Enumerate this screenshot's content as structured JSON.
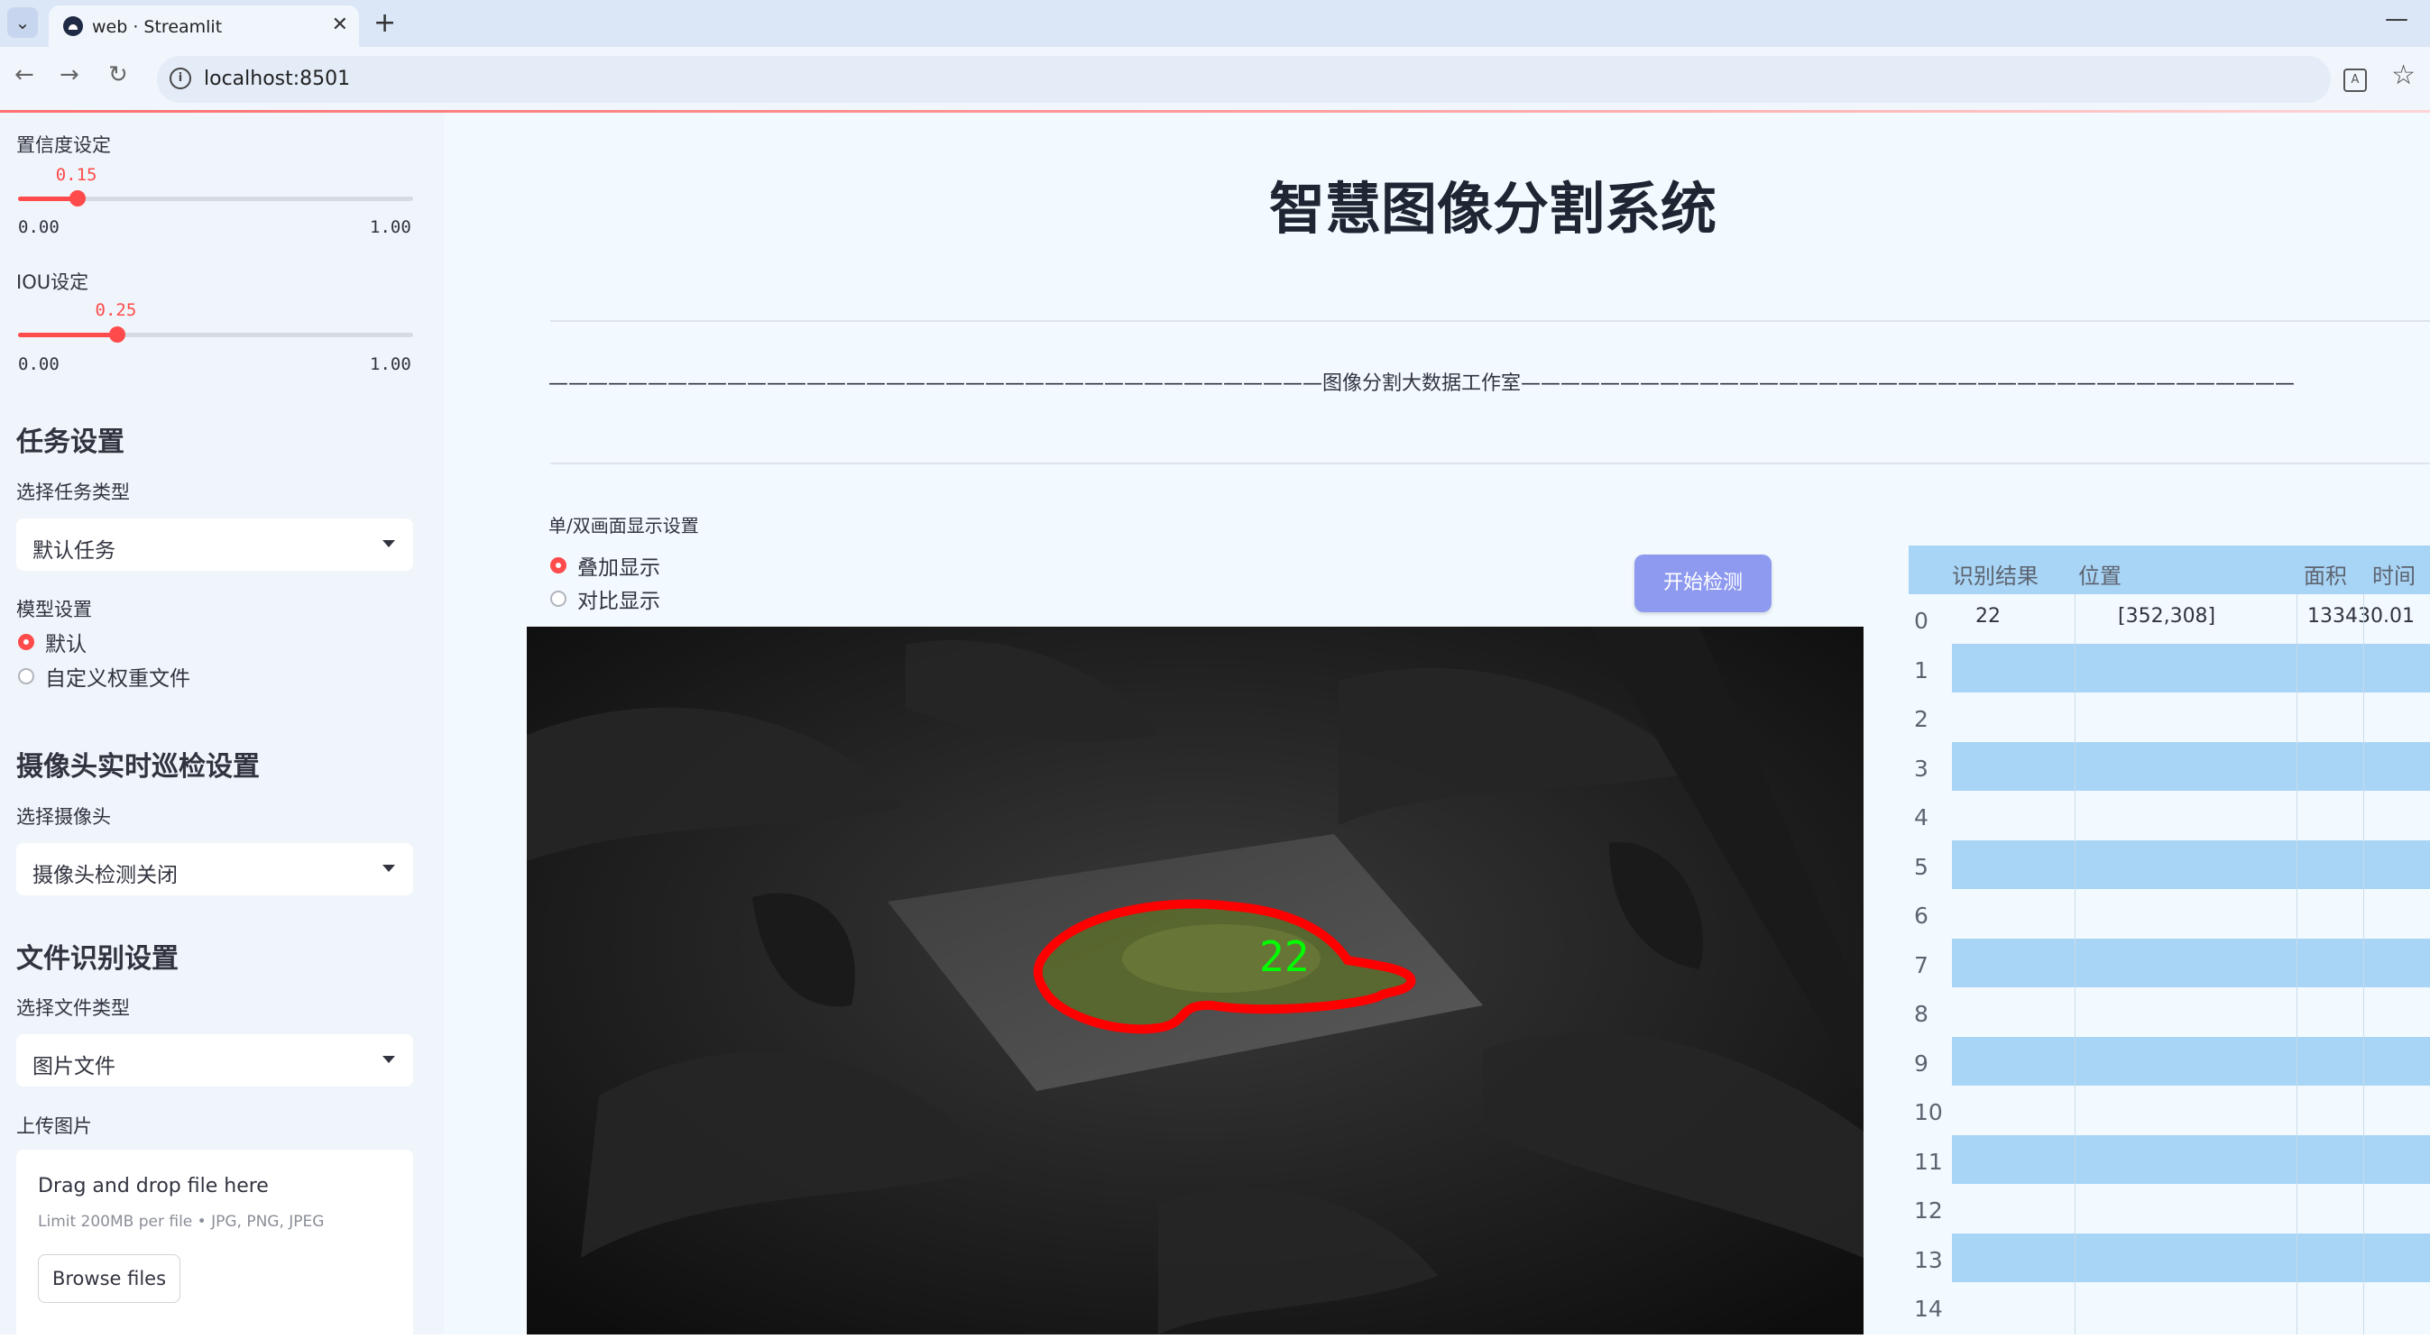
{
  "browser": {
    "tab_title": "web · Streamlit",
    "close_glyph": "✕",
    "newtab_glyph": "+",
    "minimize_glyph": "—",
    "url": "localhost:8501",
    "icons": [
      "tab-list-icon",
      "favicon-icon",
      "back-icon",
      "forward-icon",
      "reload-icon",
      "site-info-icon",
      "translate-icon",
      "bookmark-star-icon"
    ]
  },
  "sidebar": {
    "confidence": {
      "label": "置信度设定",
      "value": "0.15",
      "value_num": 0.15,
      "min": "0.00",
      "max": "1.00"
    },
    "iou": {
      "label": "IOU设定",
      "value": "0.25",
      "value_num": 0.25,
      "min": "0.00",
      "max": "1.00"
    },
    "task_heading": "任务设置",
    "task_type_label": "选择任务类型",
    "task_type_value": "默认任务",
    "model_label": "模型设置",
    "model_options": [
      "默认",
      "自定义权重文件"
    ],
    "model_selected": 0,
    "camera_heading": "摄像头实时巡检设置",
    "camera_label": "选择摄像头",
    "camera_value": "摄像头检测关闭",
    "file_heading": "文件识别设置",
    "file_type_label": "选择文件类型",
    "file_type_value": "图片文件",
    "upload_label": "上传图片",
    "upload": {
      "drop_text": "Drag and drop file here",
      "limit_text": "Limit 200MB per file • JPG, PNG, JPEG",
      "browse_label": "Browse files"
    }
  },
  "main": {
    "title": "智慧图像分割系统",
    "banner": "———————————————————————————————————————图像分割大数据工作室———————————————————————————————————————",
    "display_label": "单/双画面显示设置",
    "display_options": [
      "叠加显示",
      "对比显示"
    ],
    "display_selected": 0,
    "detect_button": "开始检测",
    "detection_label": "22",
    "colors": {
      "accent": "#ff4b4b",
      "button": "#8e9aef",
      "table_stripe": "#a8d4f5",
      "mask_outline": "#ff0000",
      "mask_label": "#00ff00"
    }
  },
  "table": {
    "headers": [
      "识别结果",
      "位置",
      "面积",
      "时间"
    ],
    "rows": [
      {
        "index": "0",
        "result": "22",
        "position": "[352,308]",
        "area": "13343",
        "time": "0.01"
      },
      {
        "index": "1",
        "result": "",
        "position": "",
        "area": "",
        "time": ""
      },
      {
        "index": "2",
        "result": "",
        "position": "",
        "area": "",
        "time": ""
      },
      {
        "index": "3",
        "result": "",
        "position": "",
        "area": "",
        "time": ""
      },
      {
        "index": "4",
        "result": "",
        "position": "",
        "area": "",
        "time": ""
      },
      {
        "index": "5",
        "result": "",
        "position": "",
        "area": "",
        "time": ""
      },
      {
        "index": "6",
        "result": "",
        "position": "",
        "area": "",
        "time": ""
      },
      {
        "index": "7",
        "result": "",
        "position": "",
        "area": "",
        "time": ""
      },
      {
        "index": "8",
        "result": "",
        "position": "",
        "area": "",
        "time": ""
      },
      {
        "index": "9",
        "result": "",
        "position": "",
        "area": "",
        "time": ""
      },
      {
        "index": "10",
        "result": "",
        "position": "",
        "area": "",
        "time": ""
      },
      {
        "index": "11",
        "result": "",
        "position": "",
        "area": "",
        "time": ""
      },
      {
        "index": "12",
        "result": "",
        "position": "",
        "area": "",
        "time": ""
      },
      {
        "index": "13",
        "result": "",
        "position": "",
        "area": "",
        "time": ""
      },
      {
        "index": "14",
        "result": "",
        "position": "",
        "area": "",
        "time": ""
      }
    ]
  }
}
